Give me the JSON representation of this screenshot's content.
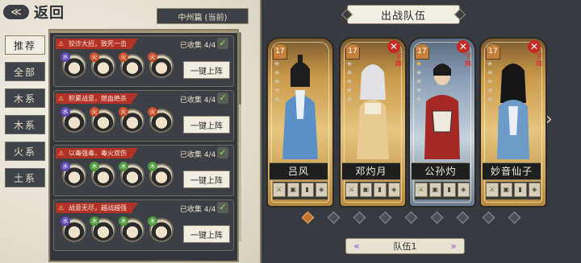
{
  "nav": {
    "back_label": "返回"
  },
  "region": {
    "label": "中州篇 (当前)"
  },
  "filters": [
    {
      "label": "推荐"
    },
    {
      "label": "全部"
    },
    {
      "label": "木系"
    },
    {
      "label": "木系"
    },
    {
      "label": "火系"
    },
    {
      "label": "土系"
    }
  ],
  "bonds": [
    {
      "title": "狡诈大招，致死一击",
      "collected": "已收集 4/4",
      "button": "一键上阵",
      "elements": [
        "水",
        "火",
        "火",
        "火"
      ]
    },
    {
      "title": "积累战意，燃血绝杀",
      "collected": "已收集 4/4",
      "button": "一键上阵",
      "elements": [
        "水",
        "火",
        "火",
        "火"
      ]
    },
    {
      "title": "以毒强毒，毒火双伤",
      "collected": "已收集 4/4",
      "button": "一键上阵",
      "elements": [
        "水",
        "木",
        "木",
        "木"
      ]
    },
    {
      "title": "战意无尽，越战越强",
      "collected": "已收集 4/4",
      "button": "一键上阵",
      "elements": [
        "水",
        "木",
        "木",
        "木"
      ]
    }
  ],
  "team": {
    "header": "出战队伍",
    "remove_text": "下阵",
    "heroes": [
      {
        "name": "吕风",
        "level": "17",
        "stars": 0,
        "has_remove": false,
        "color_theme": "gold"
      },
      {
        "name": "邓灼月",
        "level": "17",
        "stars": 0,
        "has_remove": true,
        "color_theme": "gold"
      },
      {
        "name": "公孙灼",
        "level": "17",
        "stars": 1,
        "has_remove": true,
        "color_theme": "blue"
      },
      {
        "name": "妙音仙子",
        "level": "17",
        "stars": 0,
        "has_remove": true,
        "color_theme": "gold"
      }
    ],
    "selector_label": "队伍1",
    "pager_count": 9,
    "pager_active": 0
  },
  "colors": {
    "accent_red": "#b23228",
    "panel_dark": "#33373d",
    "gold": "#c89848"
  }
}
